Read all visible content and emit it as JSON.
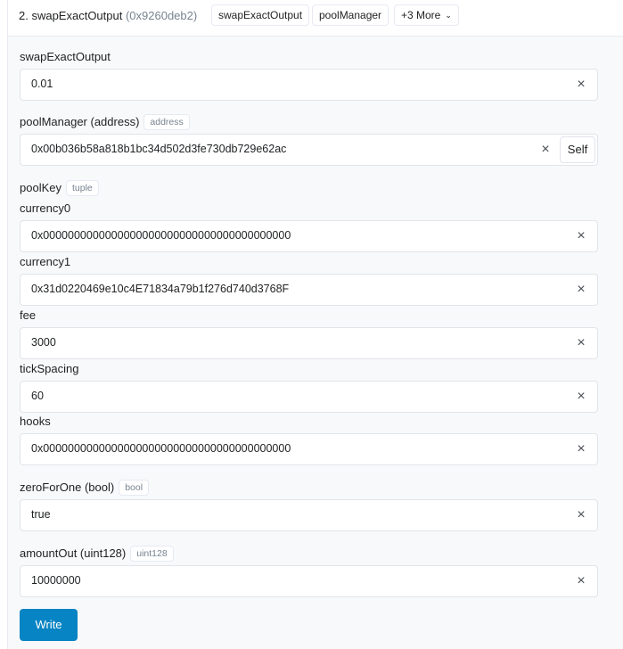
{
  "header": {
    "title": "2. swapExactOutput",
    "address": "(0x9260deb2)",
    "chips": [
      "swapExactOutput",
      "poolManager",
      "+3 More"
    ]
  },
  "fields": {
    "swapExactOutput": {
      "label": "swapExactOutput",
      "value": "0.01"
    },
    "poolManager": {
      "label": "poolManager (address)",
      "badge": "address",
      "value": "0x00b036b58a818b1bc34d502d3fe730db729e62ac",
      "self_label": "Self"
    },
    "poolKey": {
      "label": "poolKey",
      "badge": "tuple",
      "currency0": {
        "label": "currency0",
        "value": "0x0000000000000000000000000000000000000000"
      },
      "currency1": {
        "label": "currency1",
        "value": "0x31d0220469e10c4E71834a79b1f276d740d3768F"
      },
      "fee": {
        "label": "fee",
        "value": "3000"
      },
      "tickSpacing": {
        "label": "tickSpacing",
        "value": "60"
      },
      "hooks": {
        "label": "hooks",
        "value": "0x0000000000000000000000000000000000000000"
      }
    },
    "zeroForOne": {
      "label": "zeroForOne (bool)",
      "badge": "bool",
      "value": "true"
    },
    "amountOut": {
      "label": "amountOut (uint128)",
      "badge": "uint128",
      "value": "10000000"
    }
  },
  "clear_glyph": "×",
  "chevron_glyph": "⌄",
  "icons": {
    "clear": "close-icon",
    "dropdown": "chevron-down-icon"
  },
  "write_label": "Write",
  "colors": {
    "accent": "#0784c3",
    "muted": "#77838f",
    "border": "#e1e4ea"
  }
}
